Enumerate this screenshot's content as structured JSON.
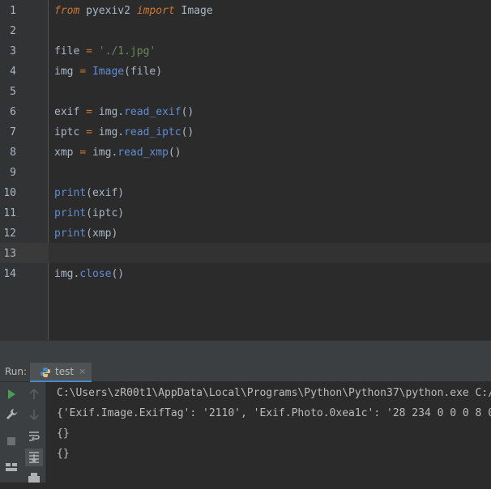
{
  "editor": {
    "line_numbers": [
      "1",
      "2",
      "3",
      "4",
      "5",
      "6",
      "7",
      "8",
      "9",
      "10",
      "11",
      "12",
      "13",
      "14"
    ],
    "lines": {
      "l1": {
        "kw_from": "from",
        "module": " pyexiv2 ",
        "kw_import": "import",
        "name": " Image"
      },
      "l3": {
        "var": "file ",
        "eq": "=",
        "sp": " ",
        "str": "'./1.jpg'"
      },
      "l4": {
        "var": "img ",
        "eq": "=",
        "sp": " ",
        "cls": "Image",
        "args": "(file)"
      },
      "l6": {
        "var": "exif ",
        "eq": "=",
        "obj": " img.",
        "fn": "read_exif",
        "args": "()"
      },
      "l7": {
        "var": "iptc ",
        "eq": "=",
        "obj": " img.",
        "fn": "read_iptc",
        "args": "()"
      },
      "l8": {
        "var": "xmp ",
        "eq": "=",
        "obj": " img.",
        "fn": "read_xmp",
        "args": "()"
      },
      "l10": {
        "fn": "print",
        "args": "(exif)"
      },
      "l11": {
        "fn": "print",
        "args": "(iptc)"
      },
      "l12": {
        "fn": "print",
        "args": "(xmp)"
      },
      "l14": {
        "obj": "img.",
        "fn": "close",
        "args": "()"
      }
    }
  },
  "run_panel": {
    "label": "Run:",
    "tab_label": "test",
    "tab_close": "×",
    "icons": [
      "play-icon",
      "wrench-icon",
      "stop-icon",
      "layout-icon",
      "print-icon",
      "up-arrow-icon",
      "down-arrow-icon",
      "soft-wrap-icon",
      "scroll-to-end-icon"
    ]
  },
  "console": {
    "lines": [
      "C:\\Users\\zR00t1\\AppData\\Local\\Programs\\Python\\Python37\\python.exe C:/",
      "{'Exif.Image.ExifTag': '2110', 'Exif.Photo.0xea1c': '28 234 0 0 0 8 0 0",
      "{}",
      "{}"
    ]
  },
  "colors": {
    "background": "#2b2b2b",
    "keyword": "#cc7832",
    "string": "#6a8759",
    "function": "#5f8dd3",
    "text": "#a9b7c6"
  }
}
